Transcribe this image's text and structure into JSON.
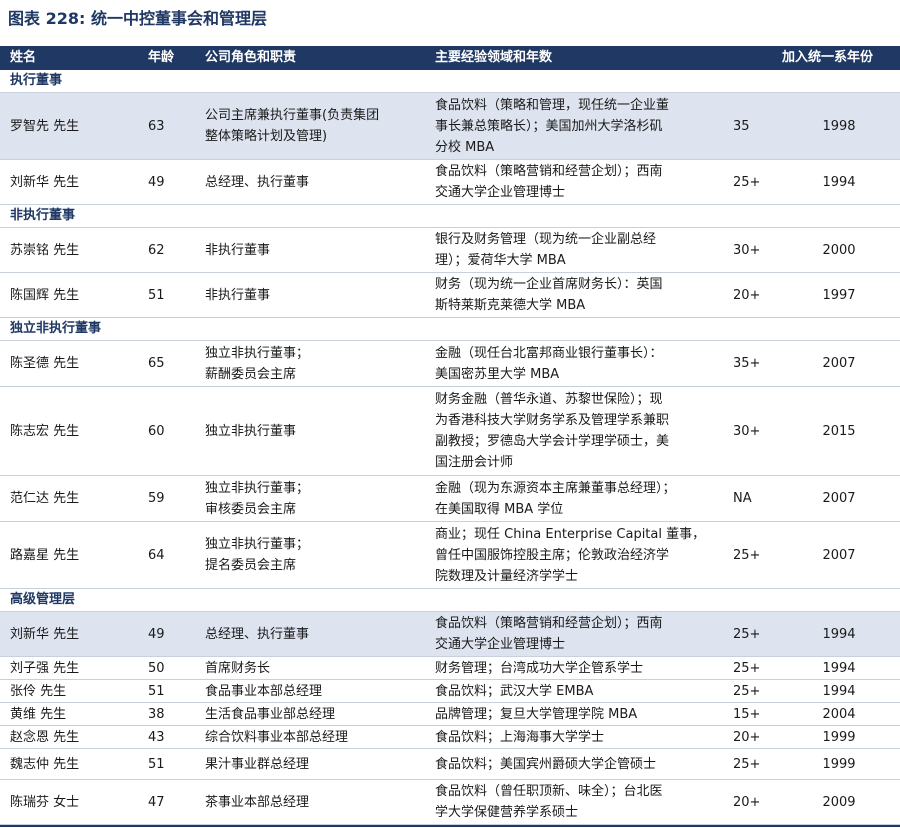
{
  "title": "图表 228: 统一中控董事会和管理层",
  "headers": {
    "name": "姓名",
    "age": "年龄",
    "role": "公司角色和职责",
    "experience": "主要经验领域和年数",
    "years": "",
    "join_year": "加入统一系年份"
  },
  "sections": [
    {
      "title": "执行董事",
      "rows": [
        {
          "name": "罗智先 先生",
          "age": "63",
          "role": "公司主席兼执行董事(负责集团\n整体策略计划及管理)",
          "experience": "食品饮料（策略和管理，现任统一企业董\n事长兼总策略长）；美国加州大学洛杉矶\n分校 MBA",
          "years": "35",
          "join_year": "1998",
          "shade": true
        },
        {
          "name": "刘新华 先生",
          "age": "49",
          "role": "总经理、执行董事",
          "experience": "食品饮料（策略营销和经营企划）；西南\n交通大学企业管理博士",
          "years": "25+",
          "join_year": "1994",
          "shade": false
        }
      ]
    },
    {
      "title": "非执行董事",
      "rows": [
        {
          "name": "苏崇铭 先生",
          "age": "62",
          "role": "非执行董事",
          "experience": "银行及财务管理（现为统一企业副总经\n理）；爱荷华大学 MBA",
          "years": "30+",
          "join_year": "2000",
          "shade": false
        },
        {
          "name": "陈国辉 先生",
          "age": "51",
          "role": "非执行董事",
          "experience": "财务（现为统一企业首席财务长）：英国\n斯特莱斯克莱德大学 MBA",
          "years": "20+",
          "join_year": "1997",
          "shade": false
        }
      ]
    },
    {
      "title": "独立非执行董事",
      "rows": [
        {
          "name": "陈圣德 先生",
          "age": "65",
          "role": "独立非执行董事；\n薪酬委员会主席",
          "experience": "金融（现任台北富邦商业银行董事长）：\n美国密苏里大学 MBA",
          "years": "35+",
          "join_year": "2007",
          "shade": false
        },
        {
          "name": "陈志宏 先生",
          "age": "60",
          "role": "独立非执行董事",
          "experience": "财务金融（普华永道、苏黎世保险）；现\n为香港科技大学财务学系及管理学系兼职\n副教授；罗德岛大学会计学理学硕士，美\n国注册会计师",
          "years": "30+",
          "join_year": "2015",
          "shade": false
        },
        {
          "name": "范仁达 先生",
          "age": "59",
          "role": "独立非执行董事；\n审核委员会主席",
          "experience": "金融（现为东源资本主席兼董事总经理）；\n在美国取得 MBA 学位",
          "years": "NA",
          "join_year": "2007",
          "shade": false
        },
        {
          "name": "路嘉星 先生",
          "age": "64",
          "role": "独立非执行董事；\n提名委员会主席",
          "experience": "商业；现任 China Enterprise Capital 董事，\n曾任中国服饰控股主席；伦敦政治经济学\n院数理及计量经济学学士",
          "years": "25+",
          "join_year": "2007",
          "shade": false
        }
      ]
    },
    {
      "title": "高级管理层",
      "rows": [
        {
          "name": "刘新华 先生",
          "age": "49",
          "role": "总经理、执行董事",
          "experience": "食品饮料（策略营销和经营企划）；西南\n交通大学企业管理博士",
          "years": "25+",
          "join_year": "1994",
          "shade": true
        },
        {
          "name": "刘子强 先生",
          "age": "50",
          "role": "首席财务长",
          "experience": "财务管理；台湾成功大学企管系学士",
          "years": "25+",
          "join_year": "1994",
          "shade": false
        },
        {
          "name": "张伶 先生",
          "age": "51",
          "role": "食品事业本部总经理",
          "experience": "食品饮料；武汉大学 EMBA",
          "years": "25+",
          "join_year": "1994",
          "shade": false
        },
        {
          "name": "黄维 先生",
          "age": "38",
          "role": "生活食品事业部总经理",
          "experience": "品牌管理；复旦大学管理学院 MBA",
          "years": "15+",
          "join_year": "2004",
          "shade": false
        },
        {
          "name": "赵念恩 先生",
          "age": "43",
          "role": "综合饮料事业本部总经理",
          "experience": "食品饮料；上海海事大学学士",
          "years": "20+",
          "join_year": "1999",
          "shade": false
        },
        {
          "name": "魏志仲 先生",
          "age": "51",
          "role": "果汁事业群总经理",
          "experience": "食品饮料；美国宾州爵硕大学企管硕士",
          "years": "25+",
          "join_year": "1999",
          "shade": false
        },
        {
          "name": "陈瑞芬 女士",
          "age": "47",
          "role": "茶事业本部总经理",
          "experience": "食品饮料（曾任职顶新、味全）；台北医\n学大学保健营养学系硕士",
          "years": "20+",
          "join_year": "2009",
          "shade": false
        }
      ]
    }
  ]
}
